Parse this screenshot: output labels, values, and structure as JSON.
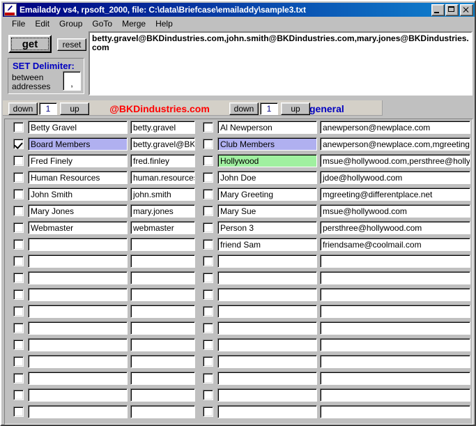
{
  "window": {
    "title": "Emailaddy vs4, rpsoft_2000, file: C:\\data\\Briefcase\\emailaddy\\sample3.txt",
    "icon": "app-icon",
    "buttons": {
      "minimize": "minimize-button",
      "maximize": "maximize-button",
      "close": "close-button"
    }
  },
  "menubar": {
    "items": [
      {
        "label": "File"
      },
      {
        "label": "Edit"
      },
      {
        "label": "Group"
      },
      {
        "label": "GoTo"
      },
      {
        "label": "Merge"
      },
      {
        "label": "Help"
      }
    ]
  },
  "toolbar": {
    "get_label": "get",
    "reset_label": "reset",
    "delimiter": {
      "title": "SET Delimiter:",
      "line1": "between",
      "line2": "addresses",
      "value": ","
    },
    "output_text": "betty.gravel@BKDindustries.com,john.smith@BKDindustries.com,mary.jones@BKDindustries.com"
  },
  "navbar": {
    "left": {
      "down_label": "down",
      "page": "1",
      "up_label": "up",
      "title": "@BKDindustries.com",
      "title_color": "#ff0000"
    },
    "right": {
      "down_label": "down",
      "page": "1",
      "up_label": "up",
      "title": "general",
      "title_color": "#0000c0"
    }
  },
  "grid": {
    "row_count": 18,
    "rows": [
      {
        "checked1": false,
        "name1": "Betty Gravel",
        "alias1": "betty.gravel",
        "hl1": "",
        "checked2": false,
        "name2": "Al Newperson",
        "email2": "anewperson@newplace.com",
        "hl2": ""
      },
      {
        "checked1": true,
        "name1": "Board Members",
        "alias1": "betty.gravel@BKDi",
        "hl1": "blue",
        "checked2": false,
        "name2": "Club Members",
        "email2": "anewperson@newplace.com,mgreeting@dif",
        "hl2": "blue"
      },
      {
        "checked1": false,
        "name1": "Fred Finely",
        "alias1": "fred.finley",
        "hl1": "",
        "checked2": false,
        "name2": "Hollywood",
        "email2": "msue@hollywood.com,persthree@hollywood",
        "hl2": "green"
      },
      {
        "checked1": false,
        "name1": "Human Resources",
        "alias1": "human.resources",
        "hl1": "",
        "checked2": false,
        "name2": "John Doe",
        "email2": "jdoe@hollywood.com",
        "hl2": ""
      },
      {
        "checked1": false,
        "name1": "John Smith",
        "alias1": "john.smith",
        "hl1": "",
        "checked2": false,
        "name2": "Mary Greeting",
        "email2": "mgreeting@differentplace.net",
        "hl2": ""
      },
      {
        "checked1": false,
        "name1": "Mary Jones",
        "alias1": "mary.jones",
        "hl1": "",
        "checked2": false,
        "name2": "Mary Sue",
        "email2": "msue@hollywood.com",
        "hl2": ""
      },
      {
        "checked1": false,
        "name1": "Webmaster",
        "alias1": "webmaster",
        "hl1": "",
        "checked2": false,
        "name2": "Person 3",
        "email2": "persthree@hollywood.com",
        "hl2": ""
      },
      {
        "checked1": false,
        "name1": "",
        "alias1": "",
        "hl1": "",
        "checked2": false,
        "name2": "friend Sam",
        "email2": "friendsame@coolmail.com",
        "hl2": ""
      },
      {
        "checked1": false,
        "name1": "",
        "alias1": "",
        "hl1": "",
        "checked2": false,
        "name2": "",
        "email2": "",
        "hl2": ""
      },
      {
        "checked1": false,
        "name1": "",
        "alias1": "",
        "hl1": "",
        "checked2": false,
        "name2": "",
        "email2": "",
        "hl2": ""
      },
      {
        "checked1": false,
        "name1": "",
        "alias1": "",
        "hl1": "",
        "checked2": false,
        "name2": "",
        "email2": "",
        "hl2": ""
      },
      {
        "checked1": false,
        "name1": "",
        "alias1": "",
        "hl1": "",
        "checked2": false,
        "name2": "",
        "email2": "",
        "hl2": ""
      },
      {
        "checked1": false,
        "name1": "",
        "alias1": "",
        "hl1": "",
        "checked2": false,
        "name2": "",
        "email2": "",
        "hl2": ""
      },
      {
        "checked1": false,
        "name1": "",
        "alias1": "",
        "hl1": "",
        "checked2": false,
        "name2": "",
        "email2": "",
        "hl2": ""
      },
      {
        "checked1": false,
        "name1": "",
        "alias1": "",
        "hl1": "",
        "checked2": false,
        "name2": "",
        "email2": "",
        "hl2": ""
      },
      {
        "checked1": false,
        "name1": "",
        "alias1": "",
        "hl1": "",
        "checked2": false,
        "name2": "",
        "email2": "",
        "hl2": ""
      },
      {
        "checked1": false,
        "name1": "",
        "alias1": "",
        "hl1": "",
        "checked2": false,
        "name2": "",
        "email2": "",
        "hl2": ""
      },
      {
        "checked1": false,
        "name1": "",
        "alias1": "",
        "hl1": "",
        "checked2": false,
        "name2": "",
        "email2": "",
        "hl2": ""
      }
    ]
  }
}
